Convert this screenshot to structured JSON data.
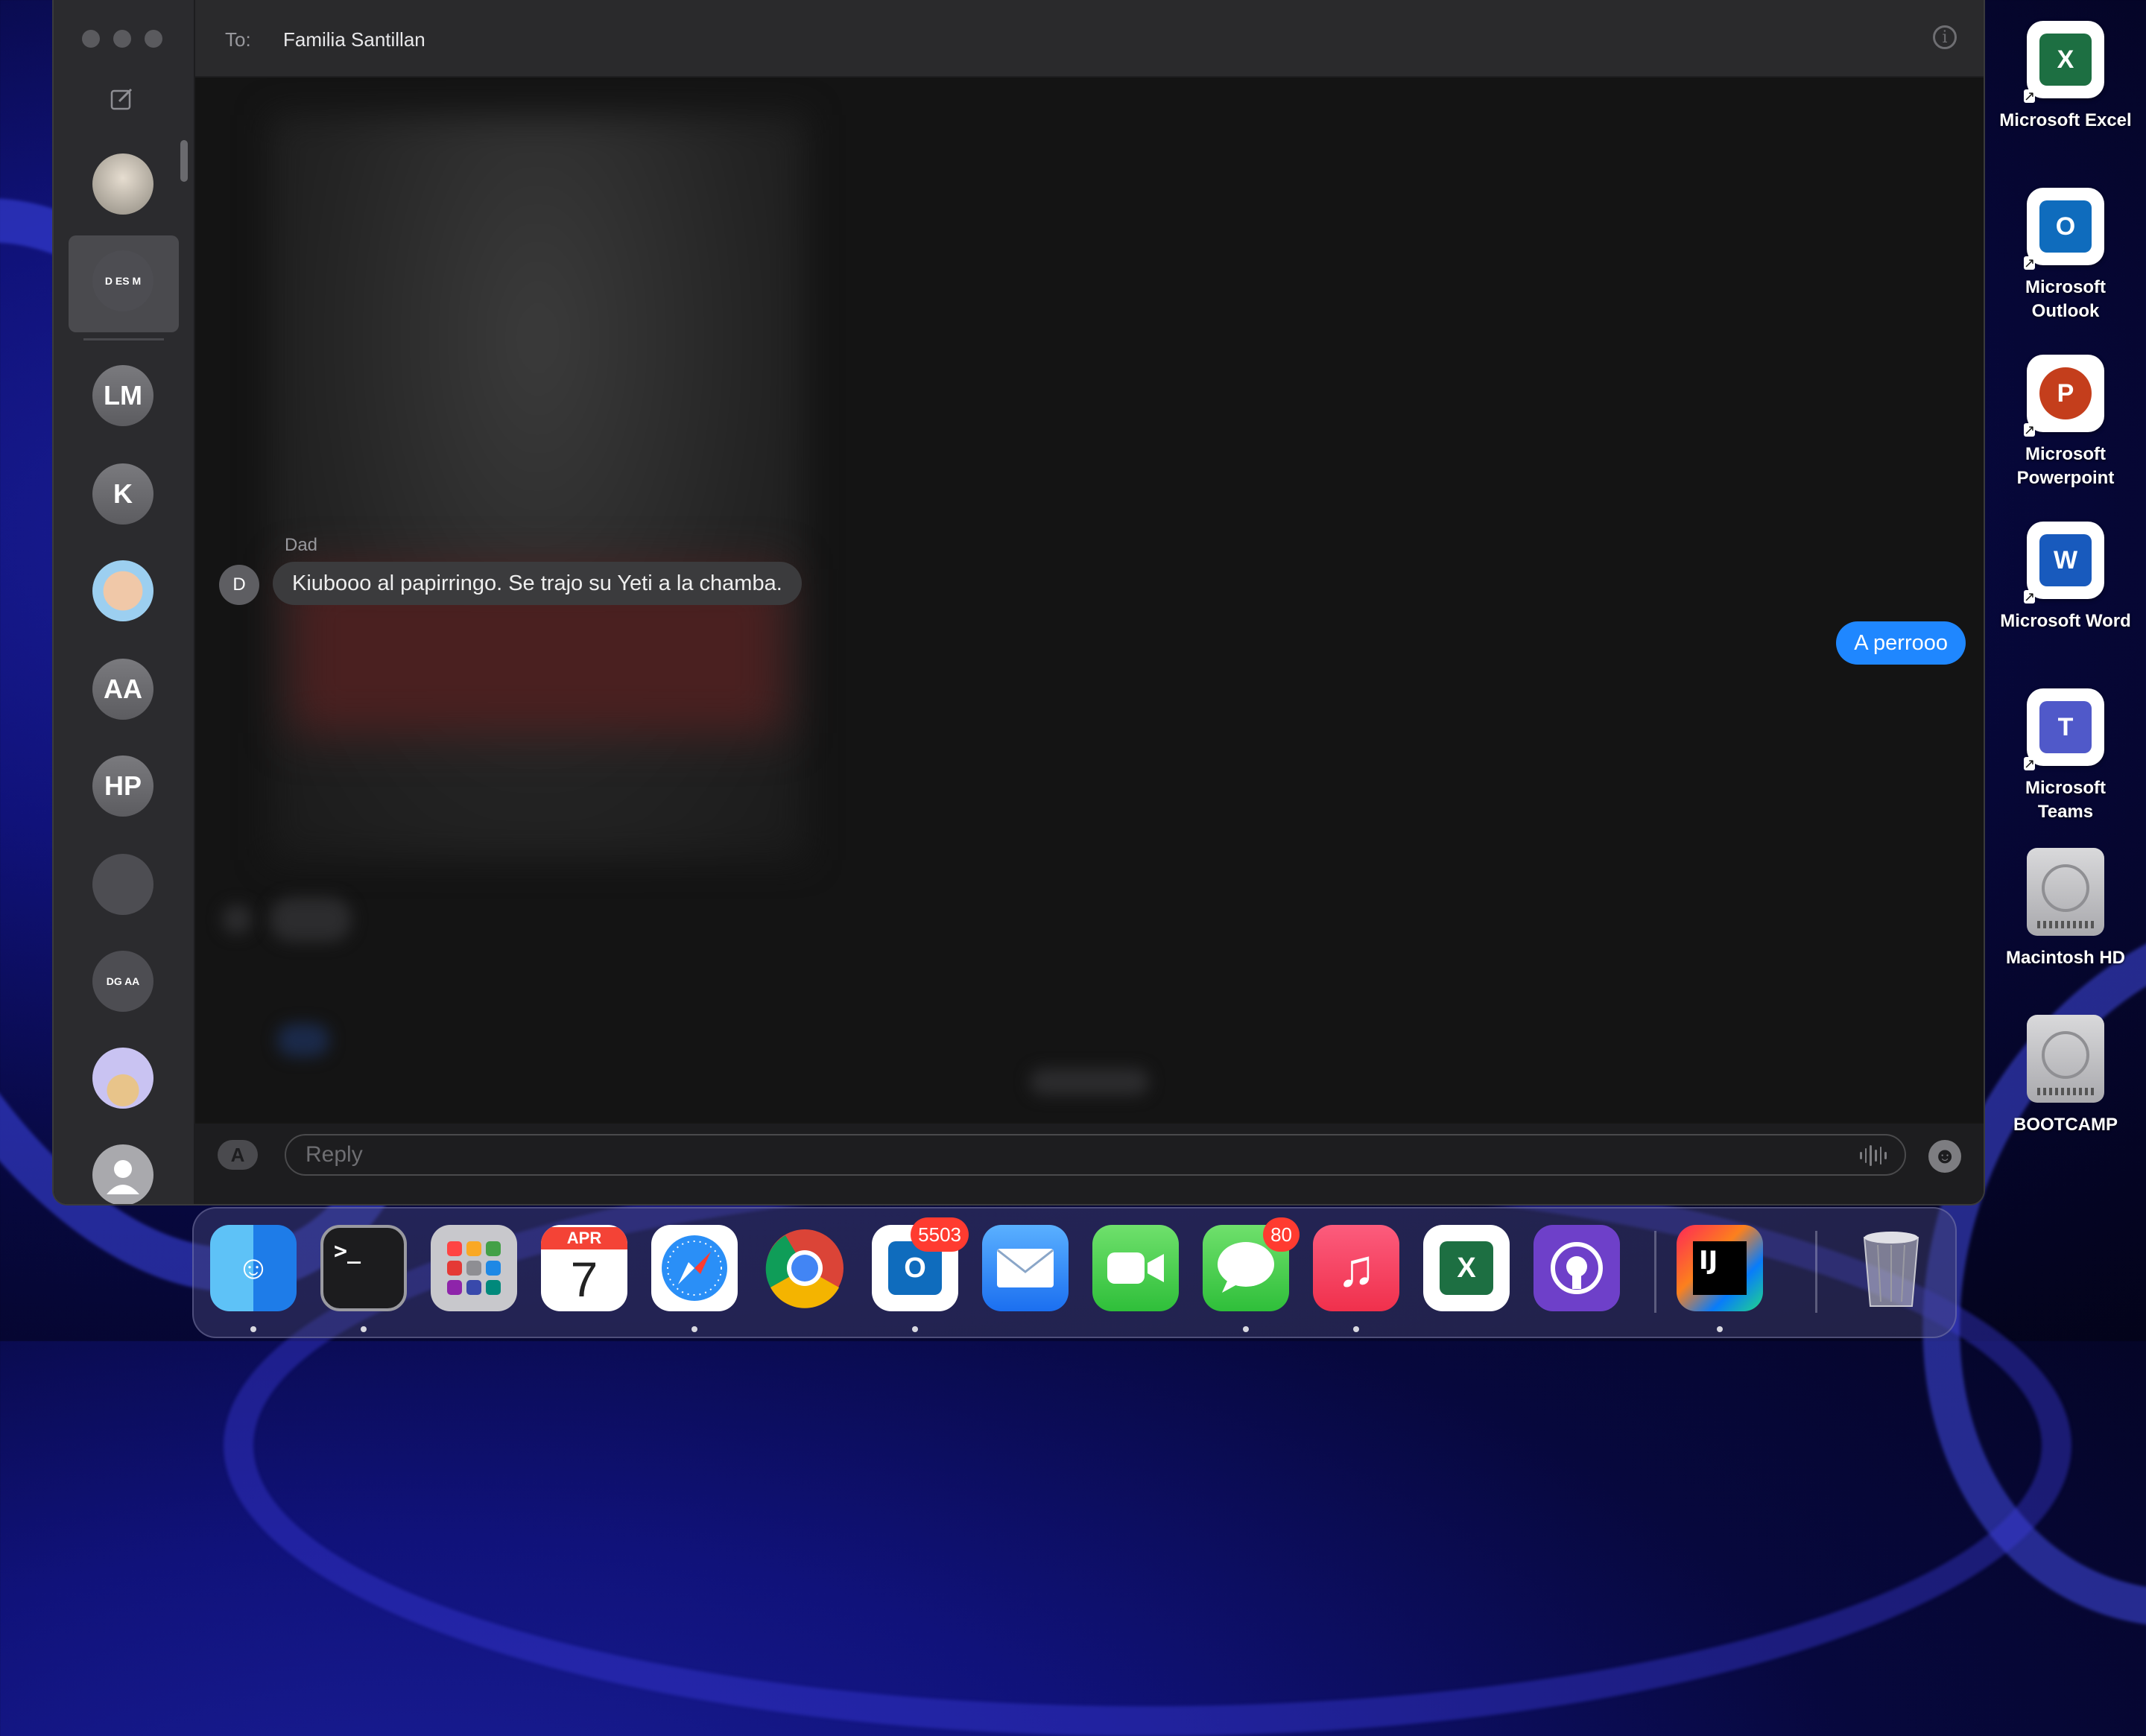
{
  "window": {
    "header": {
      "to_label": "To:",
      "recipient": "Familia Santillan"
    },
    "conversations": [
      {
        "initials": "",
        "kind": "photo"
      },
      {
        "initials": "D ES M",
        "kind": "group",
        "selected": true
      },
      {
        "initials": "LM"
      },
      {
        "initials": "K"
      },
      {
        "initials": "",
        "kind": "memoji"
      },
      {
        "initials": "AA"
      },
      {
        "initials": "HP"
      },
      {
        "initials": "",
        "kind": "group-photo"
      },
      {
        "initials": "DG AA",
        "kind": "group"
      },
      {
        "initials": "",
        "kind": "island"
      },
      {
        "initials": "",
        "kind": "person"
      }
    ],
    "messages": [
      {
        "direction": "incoming",
        "sender": "Dad",
        "avatar": "D",
        "text": "Kiubooo al papirringo. Se trajo su Yeti a la chamba."
      },
      {
        "direction": "outgoing",
        "text": "A perrooo"
      }
    ],
    "compose": {
      "placeholder": "Reply",
      "value": ""
    }
  },
  "desktop_icons": [
    {
      "label": "Microsoft Excel",
      "letter": "X",
      "color": "#1d6f42"
    },
    {
      "label": "Microsoft Outlook",
      "letter": "O",
      "color": "#0f6cbd"
    },
    {
      "label": "Microsoft Powerpoint",
      "letter": "P",
      "color": "#c43e1c"
    },
    {
      "label": "Microsoft Word",
      "letter": "W",
      "color": "#185abd"
    },
    {
      "label": "Microsoft Teams",
      "letter": "T",
      "color": "#5059c9"
    },
    {
      "label": "Macintosh HD",
      "kind": "disk"
    },
    {
      "label": "BOOTCAMP",
      "kind": "disk"
    }
  ],
  "dock": {
    "items": [
      {
        "name": "finder",
        "running": true
      },
      {
        "name": "terminal",
        "glyph": ">_",
        "running": true
      },
      {
        "name": "launchpad"
      },
      {
        "name": "calendar",
        "month": "APR",
        "day": "7"
      },
      {
        "name": "safari",
        "running": true
      },
      {
        "name": "chrome"
      },
      {
        "name": "outlook",
        "glyph": "O",
        "badge": "5503",
        "running": true
      },
      {
        "name": "mail"
      },
      {
        "name": "facetime"
      },
      {
        "name": "messages",
        "badge": "80",
        "running": true
      },
      {
        "name": "music",
        "glyph": "♫",
        "running": true
      },
      {
        "name": "excel",
        "glyph": "X"
      },
      {
        "name": "github-desktop"
      },
      {
        "name": "intellij",
        "glyph": "IJ",
        "running": true
      },
      {
        "name": "trash"
      }
    ]
  },
  "colors": {
    "accent_blue": "#1f87ff",
    "badge_red": "#ff3b30"
  }
}
